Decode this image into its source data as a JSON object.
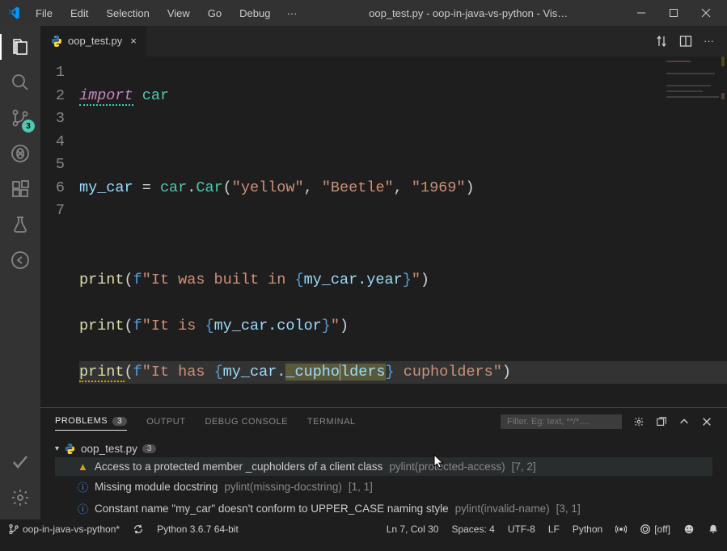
{
  "menu": {
    "file": "File",
    "edit": "Edit",
    "selection": "Selection",
    "view": "View",
    "go": "Go",
    "debug": "Debug",
    "more": "···"
  },
  "title": "oop_test.py - oop-in-java-vs-python - Vis…",
  "scm_badge": "3",
  "tab": {
    "label": "oop_test.py"
  },
  "code": {
    "lines": [
      "1",
      "2",
      "3",
      "4",
      "5",
      "6",
      "7"
    ],
    "l1_import": "import",
    "l1_mod": "car",
    "l3_var": "my_car",
    "l3_eq": " = ",
    "l3_mod": "car",
    "l3_dot": ".",
    "l3_cls": "Car",
    "l3_paren_o": "(",
    "l3_s1": "\"yellow\"",
    "l3_c1": ", ",
    "l3_s2": "\"Beetle\"",
    "l3_c2": ", ",
    "l3_s3": "\"1969\"",
    "l3_paren_c": ")",
    "l5_fn": "print",
    "l5_po": "(",
    "l5_f": "f",
    "l5_s1": "\"It was built in ",
    "l5_bo": "{",
    "l5_v": "my_car.year",
    "l5_bc": "}",
    "l5_s2": "\"",
    "l5_pc": ")",
    "l6_fn": "print",
    "l6_po": "(",
    "l6_f": "f",
    "l6_s1": "\"It is ",
    "l6_bo": "{",
    "l6_v": "my_car.color",
    "l6_bc": "}",
    "l6_s2": "\"",
    "l6_pc": ")",
    "l7_fn": "print",
    "l7_po": "(",
    "l7_f": "f",
    "l7_s1": "\"It has ",
    "l7_bo": "{",
    "l7_v1": "my_car.",
    "l7_v2": "_cupho",
    "l7_v3": "lders",
    "l7_bc": "}",
    "l7_s2": " cupholders\"",
    "l7_pc": ")"
  },
  "panel": {
    "problems": "PROBLEMS",
    "problems_count": "3",
    "output": "OUTPUT",
    "debug_console": "DEBUG CONSOLE",
    "terminal": "TERMINAL",
    "filter_placeholder": "Filter. Eg: text, **/*....",
    "file": "oop_test.py",
    "file_count": "3",
    "p1_msg": "Access to a protected member _cupholders of a client class",
    "p1_src": "pylint(protected-access)",
    "p1_loc": "[7, 2]",
    "p2_msg": "Missing module docstring",
    "p2_src": "pylint(missing-docstring)",
    "p2_loc": "[1, 1]",
    "p3_msg": "Constant name \"my_car\" doesn't conform to UPPER_CASE naming style",
    "p3_src": "pylint(invalid-name)",
    "p3_loc": "[3, 1]"
  },
  "status": {
    "branch": "oop-in-java-vs-python*",
    "interpreter": "Python 3.6.7 64-bit",
    "pos": "Ln 7, Col 30",
    "spaces": "Spaces: 4",
    "encoding": "UTF-8",
    "eol": "LF",
    "lang": "Python",
    "screencast": "[off]"
  }
}
